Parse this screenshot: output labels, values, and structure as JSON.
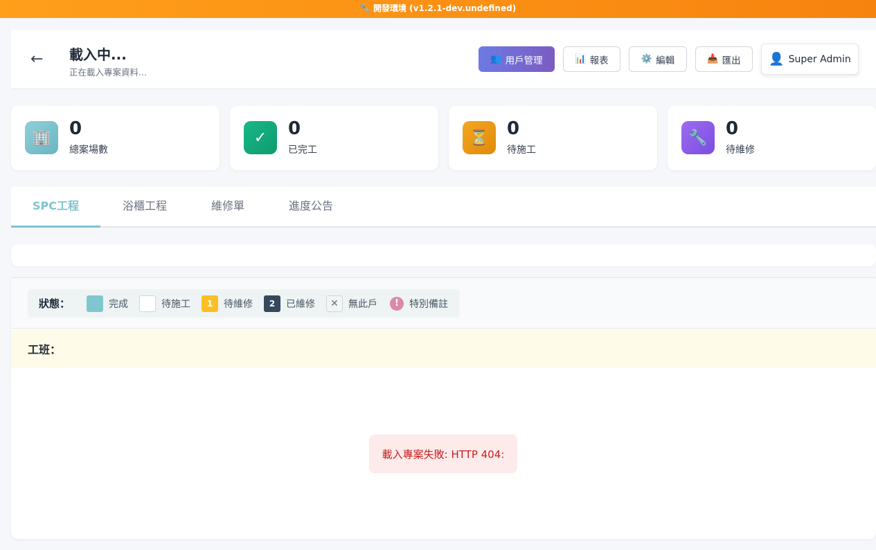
{
  "banner": {
    "icon": "🔧",
    "text": "開發環境 (v1.2.1-dev.undefined)"
  },
  "header": {
    "back_icon": "←",
    "title": "載入中...",
    "subtitle": "正在載入專案資料...",
    "buttons": [
      {
        "icon": "👥",
        "label": "用戶管理"
      },
      {
        "icon": "📊",
        "label": "報表"
      },
      {
        "icon": "⚙️",
        "label": "編輯"
      },
      {
        "icon": "📥",
        "label": "匯出"
      }
    ],
    "user": {
      "icon": "👤",
      "label": "Super Admin"
    }
  },
  "stats": [
    {
      "icon": "🏢",
      "value": "0",
      "label": "總案場數",
      "color": "#7ec4cf"
    },
    {
      "icon": "✓",
      "value": "0",
      "label": "已完工",
      "color": "#10b981"
    },
    {
      "icon": "⏳",
      "value": "0",
      "label": "待施工",
      "color": "#f59e0b"
    },
    {
      "icon": "🔧",
      "value": "0",
      "label": "待維修",
      "color": "#8b5cf6"
    }
  ],
  "tabs": [
    {
      "label": "SPC工程",
      "active": true
    },
    {
      "label": "浴櫃工程",
      "active": false
    },
    {
      "label": "維修單",
      "active": false
    },
    {
      "label": "進度公告",
      "active": false
    }
  ],
  "legend": {
    "title": "狀態：",
    "items": [
      {
        "swatch": "",
        "label": "完成"
      },
      {
        "swatch": "",
        "label": "待施工"
      },
      {
        "swatch": "1",
        "label": "待維修"
      },
      {
        "swatch": "2",
        "label": "已維修"
      },
      {
        "swatch": "✕",
        "label": "無此戶"
      },
      {
        "swatch": "!",
        "label": "特別備註"
      }
    ]
  },
  "crew": {
    "label": "工班："
  },
  "error": {
    "message": "載入專案失敗: HTTP 404:"
  }
}
